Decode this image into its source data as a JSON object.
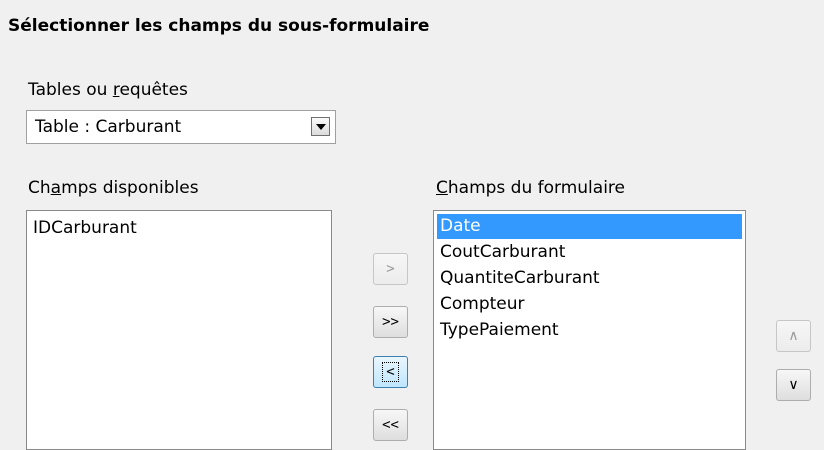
{
  "page_title": "Sélectionner les champs du sous-formulaire",
  "tables": {
    "label_pre": "Tables ou ",
    "label_accel": "r",
    "label_post": "equêtes",
    "selected": "Table : Carburant"
  },
  "available": {
    "label_pre": "Ch",
    "label_accel": "a",
    "label_post": "mps disponibles",
    "items": [
      "IDCarburant"
    ]
  },
  "form_fields": {
    "label_accel": "C",
    "label_post": "hamps du formulaire",
    "items": [
      "Date",
      "CoutCarburant",
      "QuantiteCarburant",
      "Compteur",
      "TypePaiement"
    ],
    "selected_index": 0
  },
  "transfer_buttons": {
    "add": ">",
    "add_all": ">>",
    "remove": "<",
    "remove_all": "<<"
  },
  "order_buttons": {
    "up": "∧",
    "down": "∨"
  },
  "colors": {
    "selection": "#3399ff",
    "background": "#f0f0f0"
  }
}
